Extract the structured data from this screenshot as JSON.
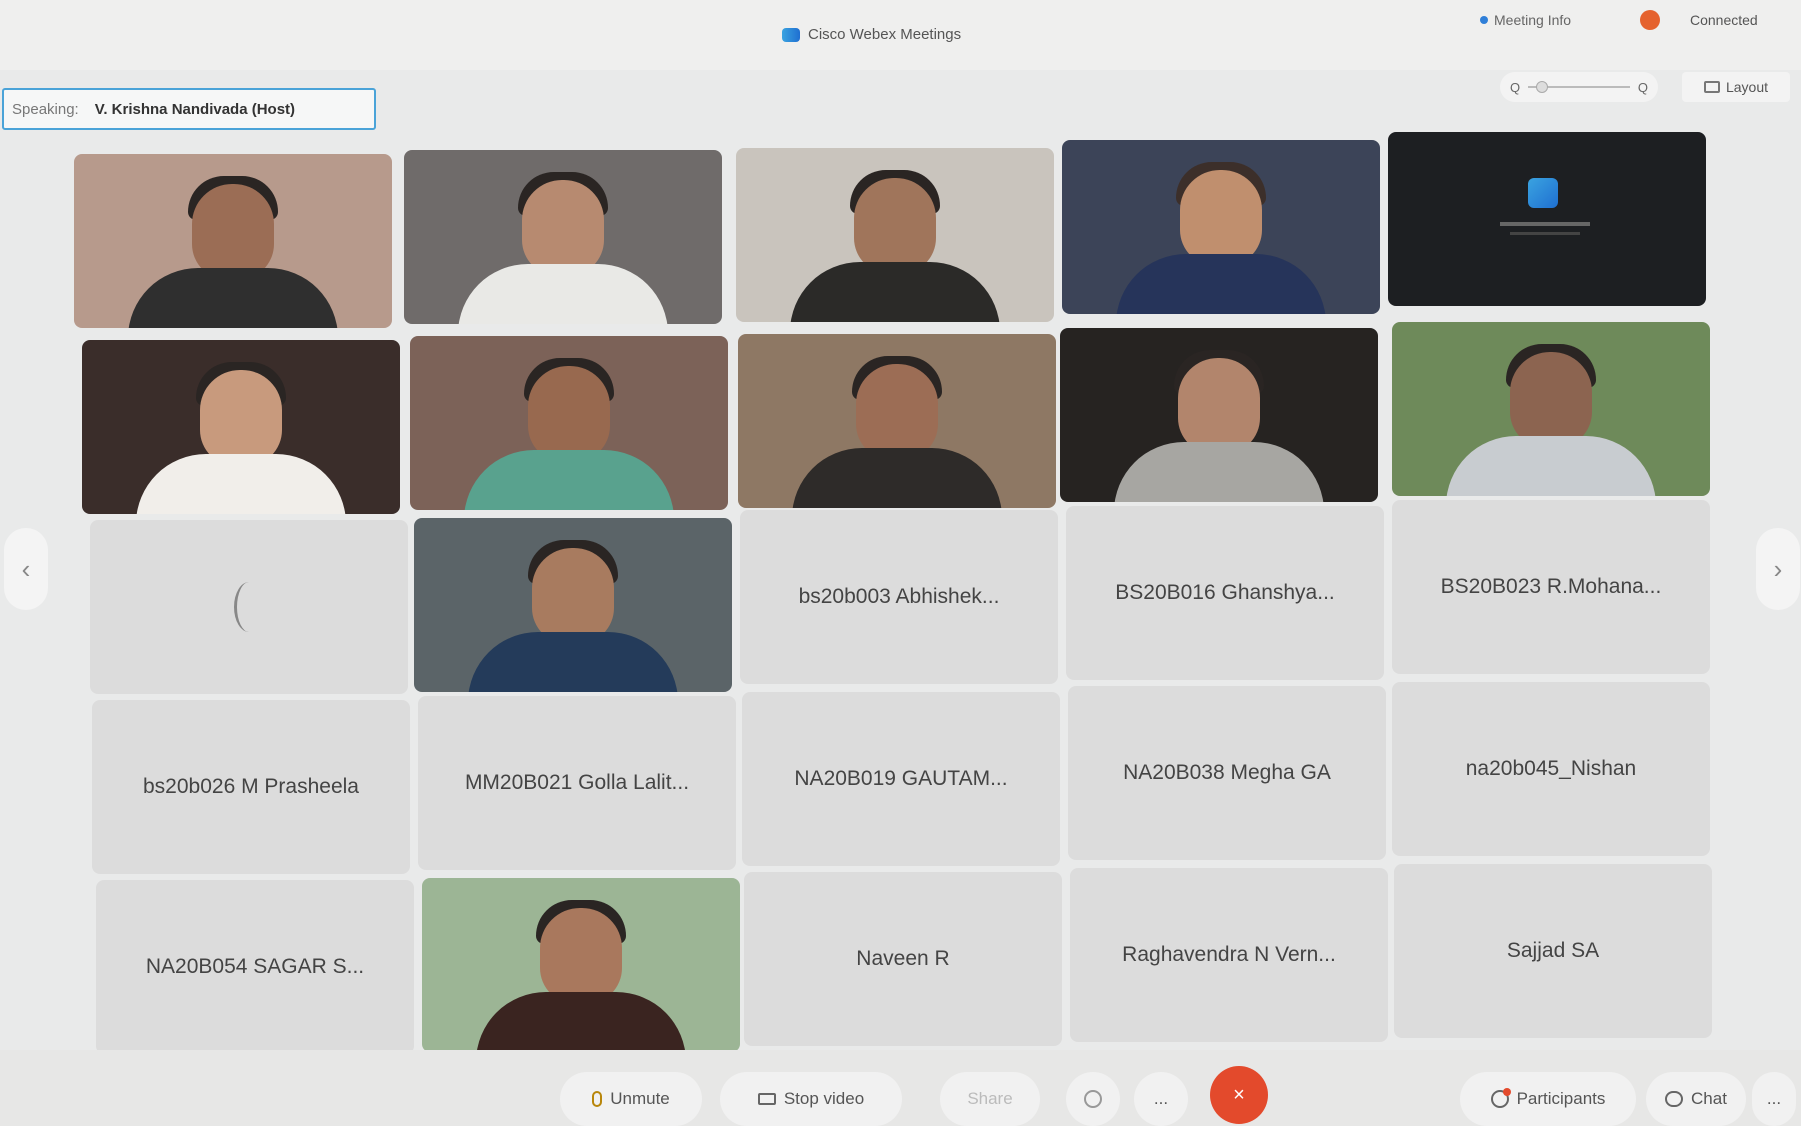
{
  "titlebar": {
    "app_title": "Cisco Webex Meetings",
    "meeting_info": "Meeting Info",
    "connection_status": "Connected"
  },
  "speaking": {
    "label": "Speaking:",
    "name": "V. Krishna Nandivada (Host)"
  },
  "zoom": {
    "min_label": "Q",
    "max_label": "Q"
  },
  "layout": {
    "label": "Layout"
  },
  "nav": {
    "prev": "‹",
    "next": "›"
  },
  "participants_grid": [
    {
      "name": "bs20b003 Abhishek...",
      "video": false
    },
    {
      "name": "BS20B016 Ghanshya...",
      "video": false
    },
    {
      "name": "BS20B023 R.Mohana...",
      "video": false
    },
    {
      "name": "bs20b026 M Prasheela",
      "video": false
    },
    {
      "name": "MM20B021 Golla Lalit...",
      "video": false
    },
    {
      "name": "NA20B019 GAUTAM...",
      "video": false
    },
    {
      "name": "NA20B038 Megha GA",
      "video": false
    },
    {
      "name": "na20b045_Nishan",
      "video": false
    },
    {
      "name": "NA20B054 SAGAR S...",
      "video": false
    },
    {
      "name": "Naveen R",
      "video": false
    },
    {
      "name": "Raghavendra N Vern...",
      "video": false
    },
    {
      "name": "Sajjad SA",
      "video": false
    }
  ],
  "controls": {
    "unmute": "Unmute",
    "stop_video": "Stop video",
    "share": "Share",
    "more": "...",
    "end": "×",
    "participants": "Participants",
    "chat": "Chat",
    "overflow": "..."
  },
  "colors": {
    "end_button": "#e34a2c",
    "speaking_border": "#4aa3d8",
    "name_tile_bg": "#dcdcdc"
  }
}
